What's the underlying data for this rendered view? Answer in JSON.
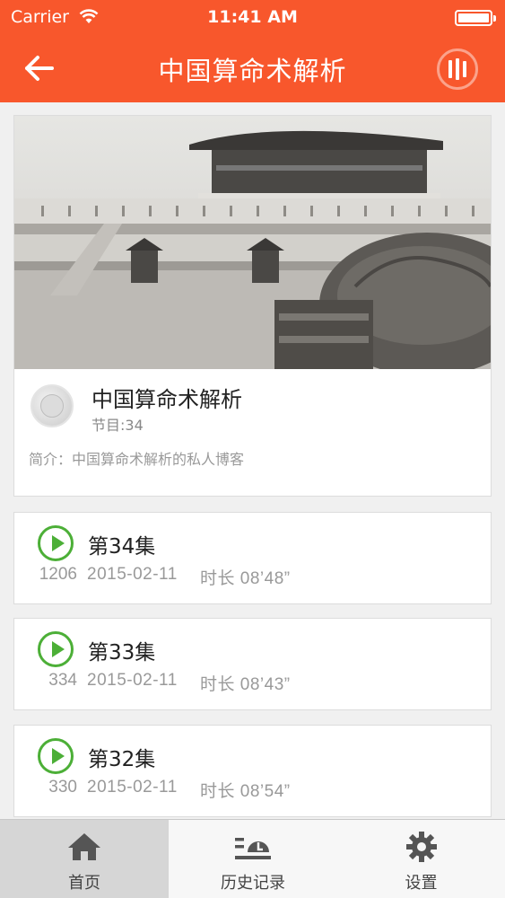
{
  "status_bar": {
    "carrier": "Carrier",
    "time": "11:41 AM"
  },
  "nav": {
    "title": "中国算命术解析",
    "back_icon": "arrow-left-icon",
    "now_playing_icon": "equalizer-icon"
  },
  "album": {
    "title": "中国算命术解析",
    "program_count": "节目:34",
    "description": "简介：中国算命术解析的私人博客"
  },
  "episodes": [
    {
      "title": "第34集",
      "plays": "1206",
      "date": "2015-02-11",
      "duration": "时长 08’48”"
    },
    {
      "title": "第33集",
      "plays": "334",
      "date": "2015-02-11",
      "duration": "时长 08’43”"
    },
    {
      "title": "第32集",
      "plays": "330",
      "date": "2015-02-11",
      "duration": "时长 08’54”"
    }
  ],
  "tabs": [
    {
      "label": "首页",
      "icon": "home-icon",
      "active": true
    },
    {
      "label": "历史记录",
      "icon": "history-icon",
      "active": false
    },
    {
      "label": "设置",
      "icon": "gear-icon",
      "active": false
    }
  ],
  "colors": {
    "brand": "#f8572c",
    "play_accent": "#4caf37"
  }
}
